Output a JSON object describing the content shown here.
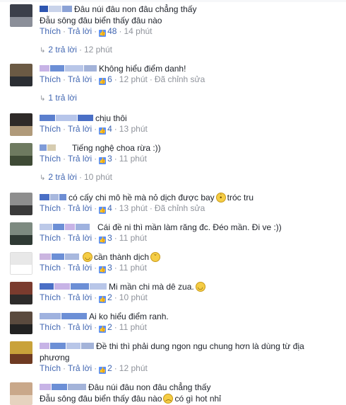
{
  "like_label": "Thích",
  "reply_label": "Trả lời",
  "edited_label": "Đã chỉnh sửa",
  "like_icon": "like-thumb-icon",
  "comments": [
    {
      "lines": [
        "Đâu núi đâu non đâu chẳng thấy",
        "Đẫu sông đâu biển thấy đâu nào"
      ],
      "likes": "48",
      "time": "14 phút",
      "edited": false,
      "avatar": [
        "#3b3f4a",
        "#8b8f99"
      ],
      "name": [
        "#2d55b0",
        "#c9d3ea",
        "#8ba2d6"
      ],
      "emoji": null
    },
    {
      "lines": [
        "Không hiểu điểm danh!"
      ],
      "likes": "6",
      "time": "12 phút",
      "edited": true,
      "avatar": [
        "#6b5a44",
        "#2b2e33"
      ],
      "name": [
        "#c7b3e6",
        "#6c8fd6",
        "#b8c6e8",
        "#a3b3d9"
      ],
      "emoji": null
    },
    {
      "lines": [
        "chịu thôi"
      ],
      "likes": "4",
      "time": "13 phút",
      "edited": false,
      "avatar": [
        "#2e2a28",
        "#b09a7a"
      ],
      "name": [
        "#5b7fce",
        "#b6c5ea",
        "#4a6fc6"
      ],
      "emoji": null
    },
    {
      "lines": [
        "Tiếng nghệ choa rừa :))"
      ],
      "likes": "3",
      "time": "11 phút",
      "edited": false,
      "avatar": [
        "#6e7a60",
        "#3e4a35"
      ],
      "name": [
        "#7f9bd8",
        "#d6ccb0"
      ],
      "emoji": null
    },
    {
      "lines": [
        "có cấy chi mô hề mà nỏ dịch được bay",
        "tróc tru"
      ],
      "likes": "4",
      "time": "13 phút",
      "edited": true,
      "avatar": [
        "#8e8e8e",
        "#3a3a3a"
      ],
      "name": [
        "#4a6fc6",
        "#a8b8de",
        "#6e8ed4"
      ],
      "emoji": "neutral"
    },
    {
      "lines": [
        "Cái đề ni thì mần làm răng đc. Đéo mần. Đi ve :))"
      ],
      "likes": "3",
      "time": "11 phút",
      "edited": false,
      "avatar": [
        "#7d8a80",
        "#2f3a34"
      ],
      "name": [
        "#bcc9e8",
        "#6c8fd6",
        "#c7b3e6",
        "#9fb2df"
      ],
      "emoji": null
    },
    {
      "lines": [
        "cần thành dịch"
      ],
      "likes": "3",
      "time": "11 phút",
      "edited": false,
      "avatar": [
        "#e8e8e8",
        "#ffffff"
      ],
      "name": [
        "#cbb5e0",
        "#6c8fd6",
        "#a8b8de"
      ],
      "emoji": "smirk"
    },
    {
      "lines": [
        "Mi mần chi mà dê zua."
      ],
      "likes": "2",
      "time": "10 phút",
      "edited": false,
      "avatar": [
        "#7a3b2e",
        "#2d2b2a"
      ],
      "name": [
        "#4a6fc6",
        "#c7b3e6",
        "#6c8fd6",
        "#b8c6e8"
      ],
      "emoji": "grin"
    },
    {
      "lines": [
        "Ai ko hiểu điểm ranh."
      ],
      "likes": "2",
      "time": "11 phút",
      "edited": false,
      "avatar": [
        "#5a4a3e",
        "#222222"
      ],
      "name": [
        "#9fb2df",
        "#6c8fd6"
      ],
      "emoji": null
    },
    {
      "lines": [
        "Đề thi thì phải dung ngon ngu chung hơn là dùng từ địa",
        "phương"
      ],
      "likes": "2",
      "time": "12 phút",
      "edited": false,
      "avatar": [
        "#c9a23a",
        "#6e3a22"
      ],
      "name": [
        "#c7b3e6",
        "#6c8fd6",
        "#b8c6e8",
        "#a3b3d9"
      ],
      "emoji": null
    },
    {
      "lines": [
        "Đâu núi đâu non đâu chẳng thấy",
        "Đẫu sông đâu biển thấy đâu nào",
        "có gì hot nhỉ"
      ],
      "likes": "",
      "time": "",
      "edited": false,
      "avatar": [
        "#c9a88a",
        "#e6d3bf"
      ],
      "name": [
        "#c7b3e6",
        "#6c8fd6",
        "#a3b3d9"
      ],
      "emoji": "sad"
    }
  ],
  "reply_links": [
    {
      "count": "2 trả lời",
      "time": "12 phút"
    },
    {
      "count": "1 trả lời",
      "time": ""
    },
    {
      "count": "2 trả lời",
      "time": "10 phút"
    }
  ]
}
